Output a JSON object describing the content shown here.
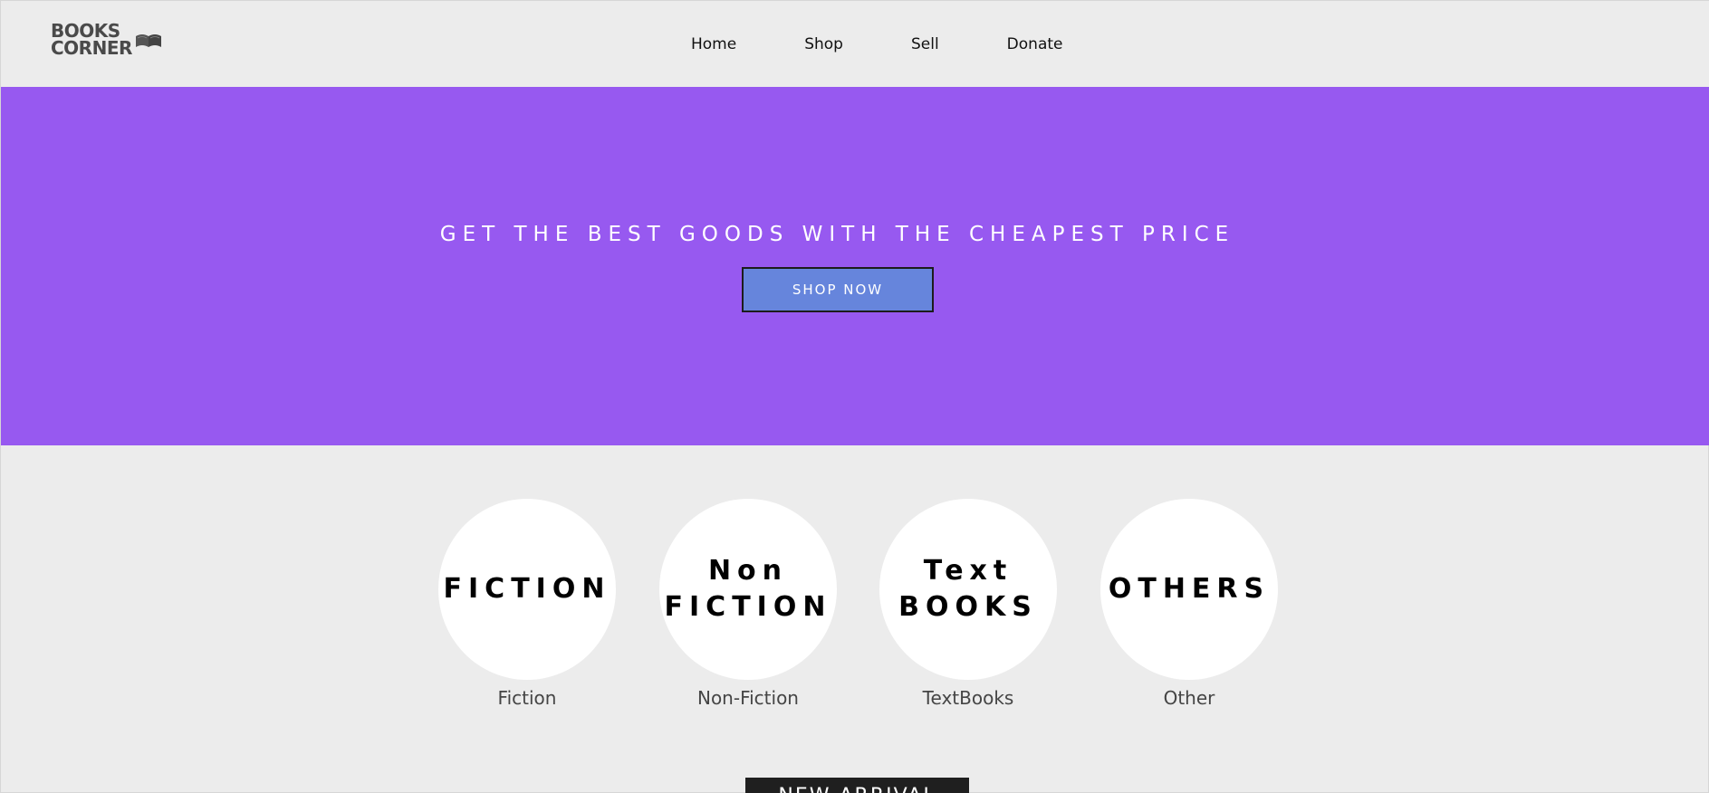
{
  "header": {
    "logo": {
      "line1": "BOOKS",
      "line2": "CORNER",
      "icon": "open-book-icon"
    },
    "nav": [
      {
        "label": "Home"
      },
      {
        "label": "Shop"
      },
      {
        "label": "Sell"
      },
      {
        "label": "Donate"
      }
    ]
  },
  "hero": {
    "title": "GET THE BEST GOODS WITH THE CHEAPEST PRICE",
    "button_label": "SHOP NOW",
    "background_color": "#9759f0",
    "button_color": "#6685dc"
  },
  "categories": [
    {
      "circle_lines": [
        "FICTION"
      ],
      "label": "Fiction"
    },
    {
      "circle_lines": [
        "Non",
        "FICTION"
      ],
      "label": "Non-Fiction"
    },
    {
      "circle_lines": [
        "Text",
        "BOOKS"
      ],
      "label": "TextBooks"
    },
    {
      "circle_lines": [
        "OTHERS"
      ],
      "label": "Other"
    }
  ],
  "new_arrival": {
    "label": "NEW ARRIVAL"
  }
}
